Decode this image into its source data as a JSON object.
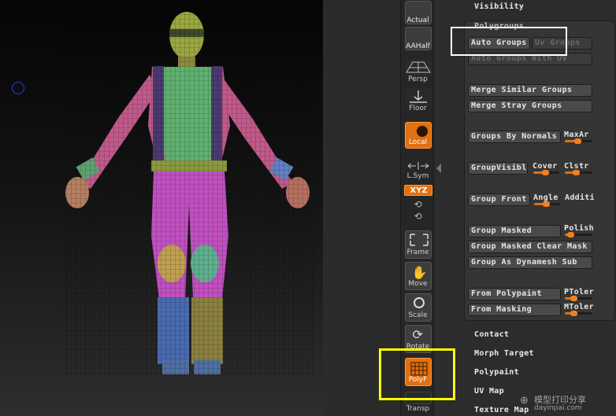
{
  "viewport": {
    "model": "polygroup-mesh-character"
  },
  "shelf": {
    "items": [
      {
        "label": "Actual",
        "icon": "magnifier-icon",
        "active": false
      },
      {
        "label": "AAHalf",
        "icon": "magnifier-icon",
        "active": false
      },
      {
        "label": "Persp",
        "icon": "perspective-grid-icon",
        "active": false
      },
      {
        "label": "Floor",
        "icon": "floor-icon",
        "active": false
      },
      {
        "label": "Local",
        "icon": "local-rotate-icon",
        "active": true
      },
      {
        "label": "L.Sym",
        "icon": "symmetry-icon",
        "active": false
      },
      {
        "label": "XYZ",
        "icon": "xyz-icon",
        "active": true
      },
      {
        "label": "Frame",
        "icon": "frame-icon",
        "active": false
      },
      {
        "label": "Move",
        "icon": "hand-icon",
        "active": false
      },
      {
        "label": "Scale",
        "icon": "magnifier-icon",
        "active": false
      },
      {
        "label": "Rotate",
        "icon": "rotate-icon",
        "active": false
      },
      {
        "label": "PolyF",
        "icon": "polyframe-icon",
        "active": true
      },
      {
        "label": "Transp",
        "icon": "transparency-icon",
        "active": false
      }
    ]
  },
  "palette": {
    "visibility": "Visibility",
    "polygroups": "Polygroups",
    "auto_groups": "Auto Groups",
    "uv_groups": "Uv Groups",
    "auto_groups_uv": "Auto Groups With UV",
    "merge_similar": "Merge Similar Groups",
    "merge_stray": "Merge Stray Groups",
    "groups_by_normals": "Groups By Normals",
    "maxangle": "MaxAr",
    "groupvisible": "GroupVisible",
    "coverage": "Cover",
    "clstr": "Clstr",
    "group_front": "Group Front",
    "angle": "Angle",
    "additive": "Additi",
    "group_masked": "Group Masked",
    "polish": "Polish",
    "group_masked_clear": "Group Masked Clear Mask",
    "group_dynamesh": "Group As Dynamesh Sub",
    "from_polypaint": "From Polypaint",
    "ptolerance": "PToler",
    "from_masking": "From Masking",
    "mtolerance": "MToler",
    "contact": "Contact",
    "morph_target": "Morph Target",
    "polypaint": "Polypaint",
    "uv_map": "UV Map",
    "texture_map": "Texture Map"
  },
  "sliders": {
    "maxangle": 0.45,
    "coverage": 0.45,
    "clstr": 0.4,
    "angle": 0.45,
    "polish": 0.2,
    "ptolerance": 0.3,
    "mtolerance": 0.3
  },
  "watermark": {
    "line1": "模型打印分享",
    "line2": "dayinpai.com"
  },
  "colors": {
    "accent": "#e07010",
    "highlight_white": "#ffffff",
    "highlight_yellow": "#ffff00"
  }
}
